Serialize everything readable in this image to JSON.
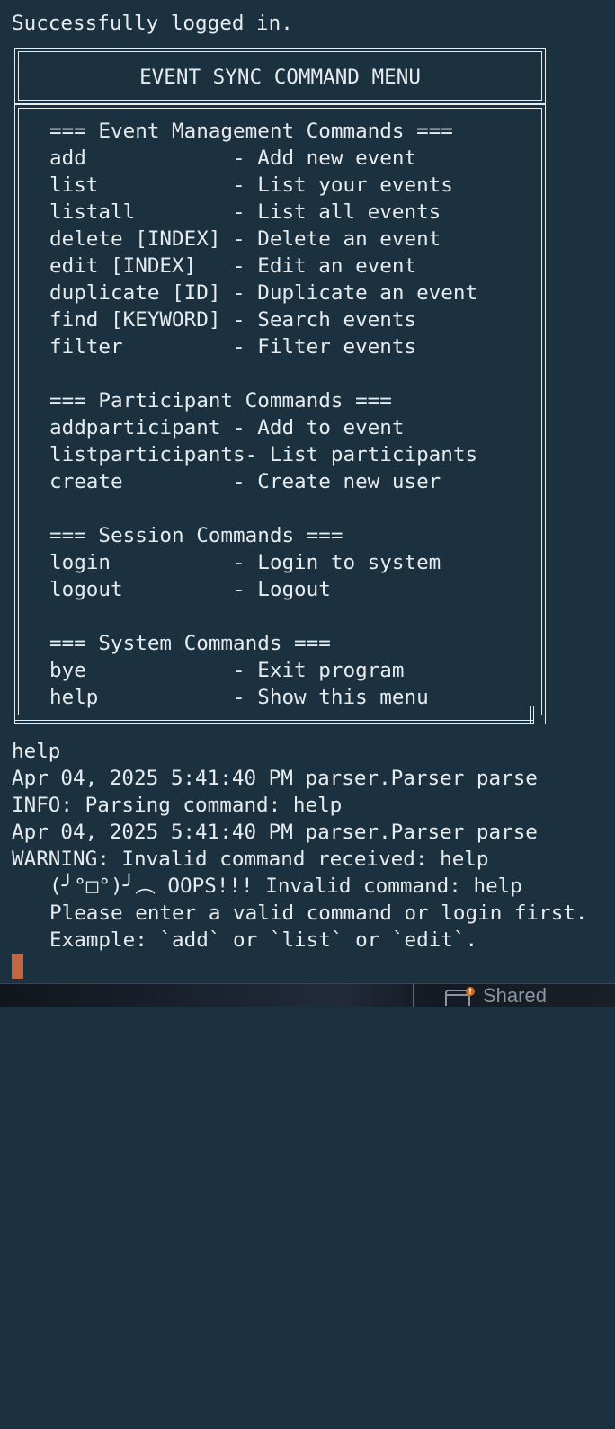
{
  "terminal": {
    "login_status": "Successfully logged in.",
    "menu_title": "EVENT SYNC COMMAND MENU",
    "menu_lines": [
      "=== Event Management Commands ===",
      "add            - Add new event",
      "list           - List your events",
      "listall        - List all events",
      "delete [INDEX] - Delete an event",
      "edit [INDEX]   - Edit an event",
      "duplicate [ID] - Duplicate an event",
      "find [KEYWORD] - Search events",
      "filter         - Filter events",
      "",
      "=== Participant Commands ===",
      "addparticipant - Add to event",
      "listparticipants- List participants",
      "create         - Create new user",
      "",
      "=== Session Commands ===",
      "login          - Login to system",
      "logout         - Logout",
      "",
      "=== System Commands ===",
      "bye            - Exit program",
      "help           - Show this menu"
    ],
    "output_lines": [
      "help",
      "Apr 04, 2025 5:41:40 PM parser.Parser parse",
      "INFO: Parsing command: help",
      "Apr 04, 2025 5:41:40 PM parser.Parser parse",
      "WARNING: Invalid command received: help"
    ],
    "error_lines": [
      "(╯°□°)╯︵ OOPS!!! Invalid command: help",
      "Please enter a valid command or login first.",
      "Example: `add` or `list` or `edit`."
    ],
    "cursor_color": "#c5663e",
    "background_color": "#1b3140",
    "text_color": "#e6ebee"
  },
  "taskbar": {
    "shared_label": "Shared",
    "shared_icon": "shared-folder-icon"
  }
}
